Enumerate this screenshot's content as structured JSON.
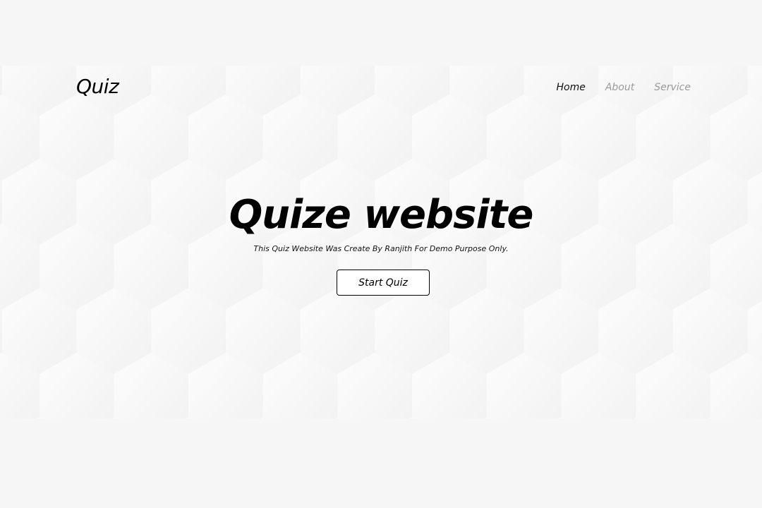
{
  "header": {
    "logo": "Quiz",
    "nav": [
      {
        "label": "Home",
        "active": true
      },
      {
        "label": "About",
        "active": false
      },
      {
        "label": "Service",
        "active": false
      }
    ]
  },
  "hero": {
    "title": "Quize website",
    "subtitle": "This Quiz Website Was Create By Ranjith For Demo Purpose Only.",
    "start_button": "Start Quiz"
  },
  "colors": {
    "page_background": "#f6f6f6",
    "hex_face": "#fbfbfb",
    "text_primary": "#000000",
    "nav_inactive": "#9a9a9a"
  }
}
